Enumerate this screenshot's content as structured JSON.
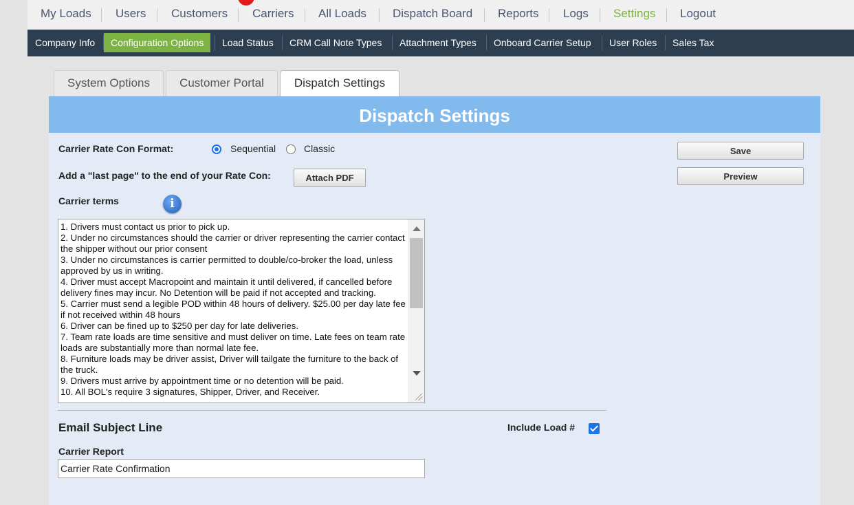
{
  "topnav": {
    "items": [
      {
        "label": "My Loads"
      },
      {
        "label": "Users"
      },
      {
        "label": "Customers"
      },
      {
        "label": "Carriers"
      },
      {
        "label": "All Loads"
      },
      {
        "label": "Dispatch Board"
      },
      {
        "label": "Reports"
      },
      {
        "label": "Logs"
      },
      {
        "label": "Settings"
      },
      {
        "label": "Logout"
      }
    ],
    "active": "Settings",
    "accent_color": "#7cb342"
  },
  "subnav": {
    "items": [
      {
        "label": "Company Info"
      },
      {
        "label": "Configuration Options"
      },
      {
        "label": "Load Status"
      },
      {
        "label": "CRM Call Note Types"
      },
      {
        "label": "Attachment Types"
      },
      {
        "label": "Onboard Carrier Setup"
      },
      {
        "label": "User Roles"
      },
      {
        "label": "Sales Tax"
      }
    ],
    "active": "Configuration Options",
    "background": "#2c3e50"
  },
  "tabs": [
    {
      "label": "System Options"
    },
    {
      "label": "Customer Portal"
    },
    {
      "label": "Dispatch Settings"
    }
  ],
  "active_tab": "Dispatch Settings",
  "panel": {
    "title": "Dispatch Settings",
    "header_color": "#82baee",
    "rate_con_format": {
      "label": "Carrier Rate Con Format:",
      "options": [
        {
          "label": "Sequential",
          "checked": true
        },
        {
          "label": "Classic",
          "checked": false
        }
      ]
    },
    "last_page": {
      "label": "Add a \"last page\" to the end of your Rate Con:",
      "button": "Attach PDF"
    },
    "buttons": {
      "save": "Save",
      "preview": "Preview"
    },
    "carrier_terms": {
      "label": "Carrier terms",
      "info_icon": "info-icon",
      "lines": [
        "1. Drivers must contact us prior to pick up.",
        "2. Under no circumstances should the carrier or driver representing the carrier contact the shipper without our prior consent",
        "3. Under no circumstances is carrier permitted to double/co-broker the load, unless approved by us in writing.",
        "4. Driver must accept Macropoint and maintain it until delivered, if cancelled before delivery fines may incur. No Detention will be paid if not accepted and tracking.",
        "5. Carrier must send a legible POD within 48 hours of delivery. $25.00 per day late fee if not received within 48 hours",
        "6. Driver can be fined up to $250 per day for late deliveries.",
        "7. Team rate loads are time sensitive and must deliver on time. Late fees on team rate loads are substantially more than normal late fee.",
        "8. Furniture loads may be driver assist, Driver will tailgate the furniture to the back of the truck.",
        "9. Drivers must arrive by appointment time or no detention will be paid.",
        "10. All BOL's require 3 signatures, Shipper, Driver, and Receiver."
      ]
    },
    "email_subject": {
      "title": "Email Subject Line",
      "include_load_label": "Include Load #",
      "include_load_checked": true,
      "carrier_report_label": "Carrier Report",
      "carrier_report_value": "Carrier Rate Confirmation"
    }
  }
}
